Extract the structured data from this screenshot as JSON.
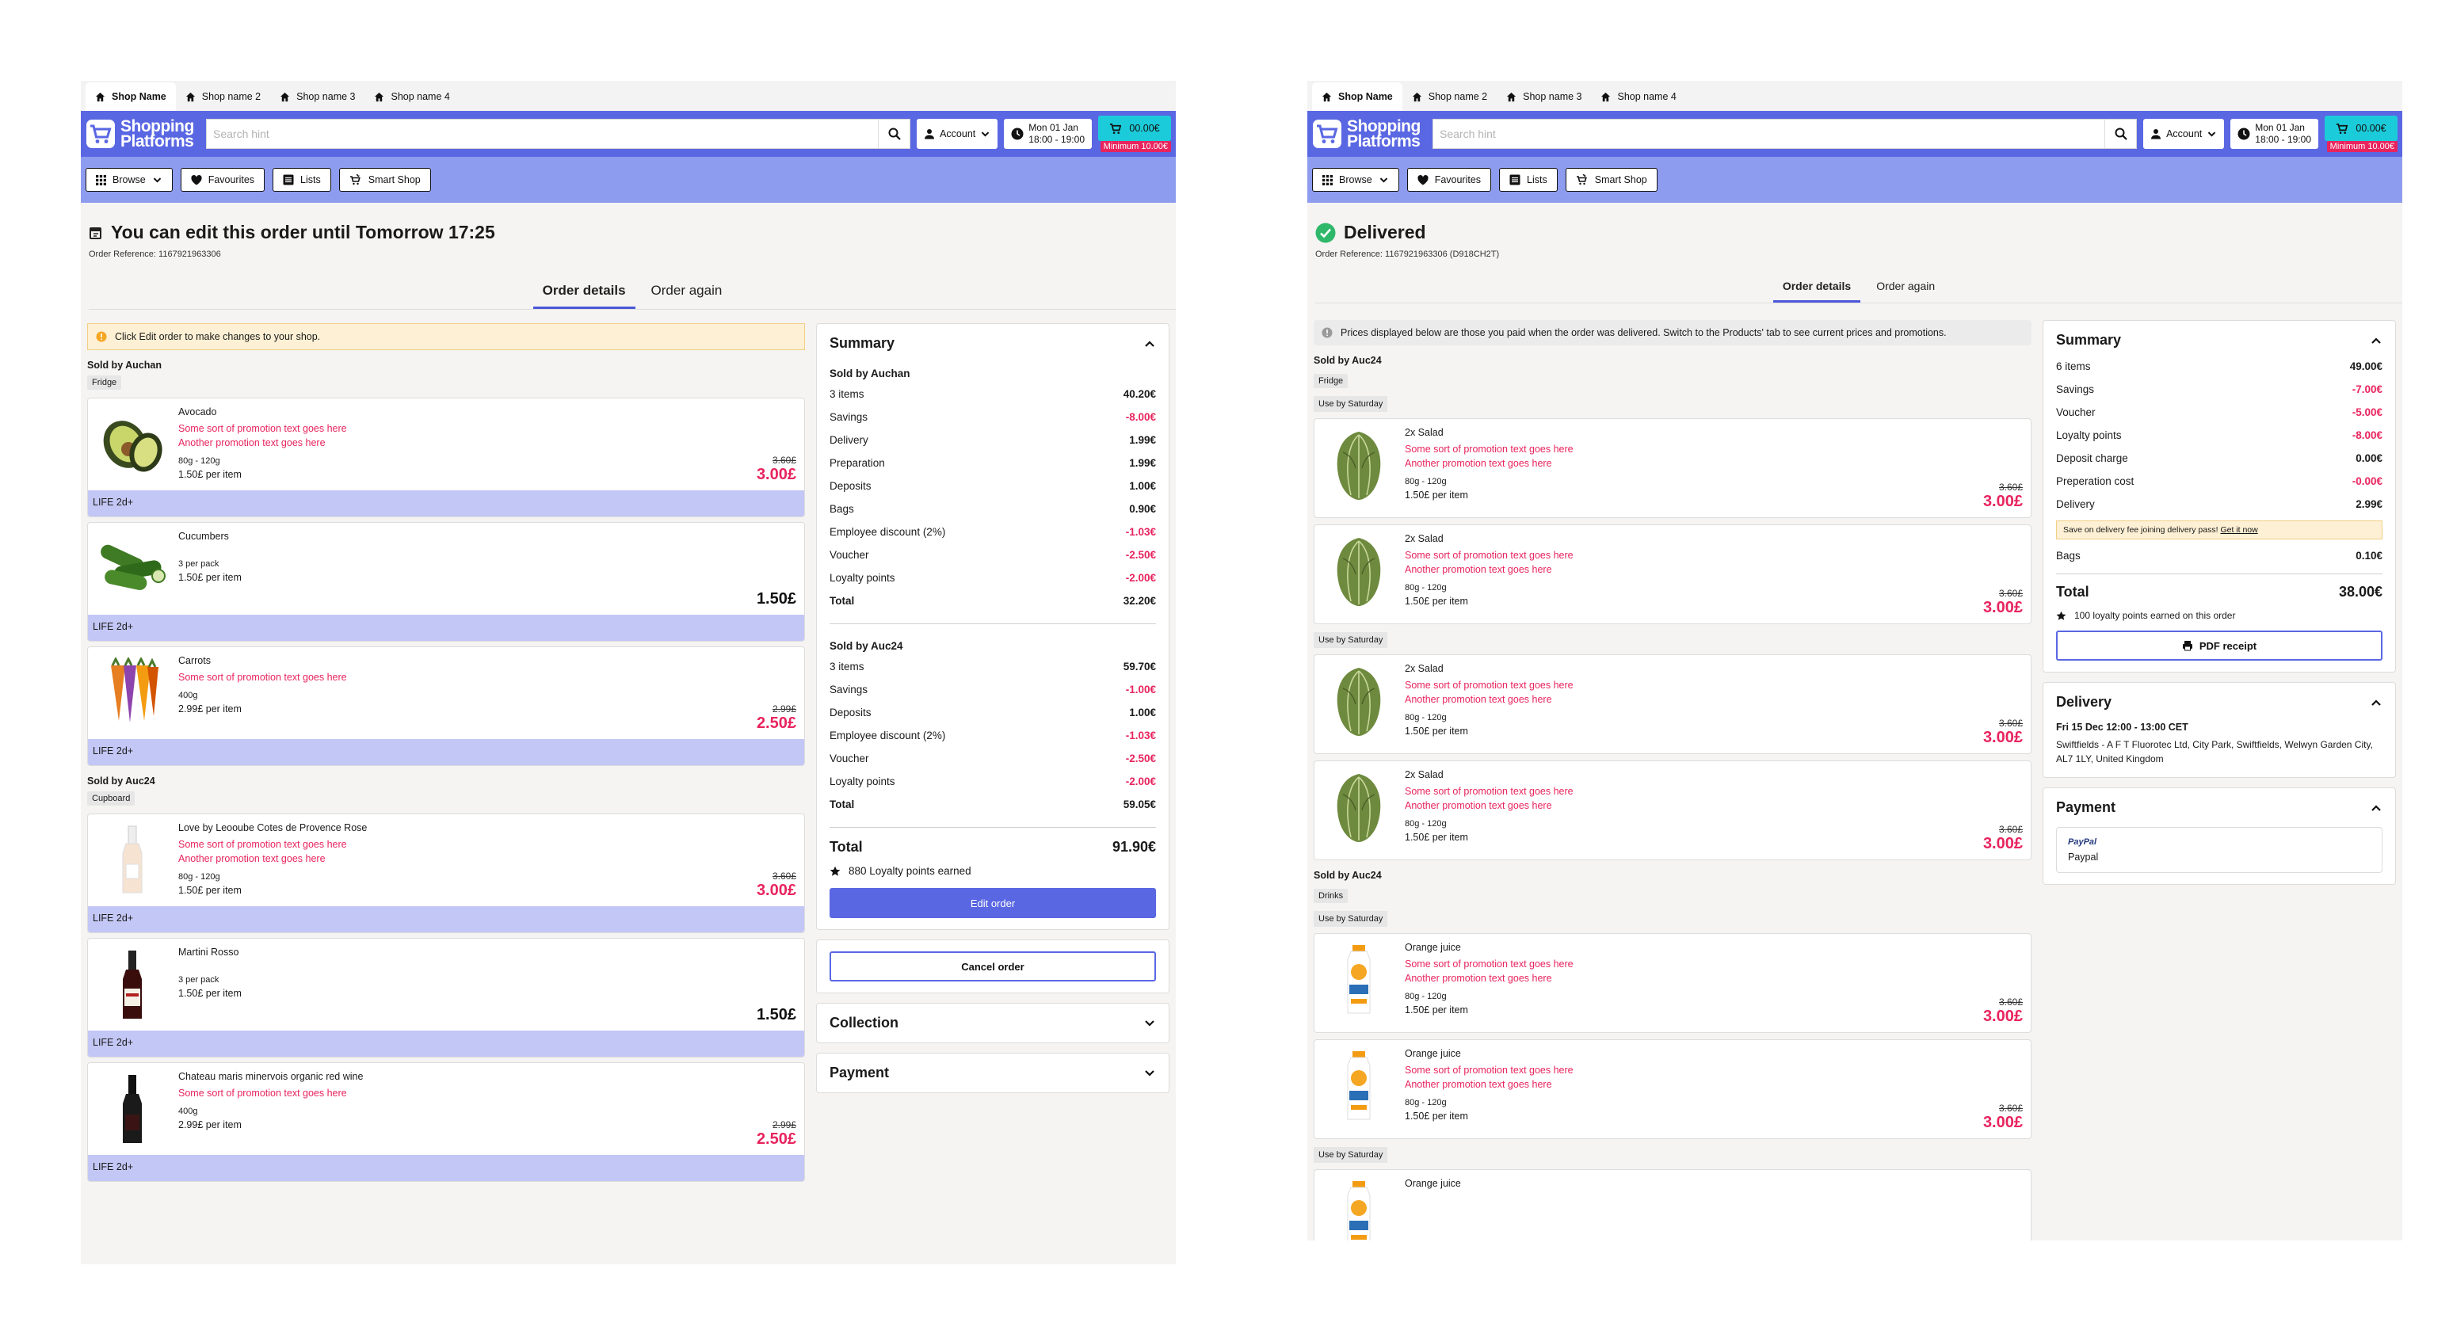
{
  "brand": {
    "line1": "Shopping",
    "line2": "Platforms"
  },
  "shop_tabs": [
    "Shop Name",
    "Shop name 2",
    "Shop name 3",
    "Shop name 4"
  ],
  "search": {
    "placeholder": "Search hint"
  },
  "account_label": "Account",
  "slot": {
    "day": "Mon 01 Jan",
    "time": "18:00 - 19:00"
  },
  "cart": {
    "amount": "00.00€",
    "minimum": "Minimum 10.00€"
  },
  "nav": [
    "Browse",
    "Favourites",
    "Lists",
    "Smart Shop"
  ],
  "order_tabs": [
    "Order details",
    "Order again"
  ],
  "left_screen": {
    "title": "You can edit this order until Tomorrow 17:25",
    "reference": "Order Reference: 1167921963306",
    "notice": "Click Edit order to make changes to your shop.",
    "groups": [
      {
        "seller": "Sold by Auchan",
        "tag": "Fridge",
        "items": [
          {
            "name": "Avocado",
            "promos": [
              "Some sort of promotion text goes here",
              "Another promotion text goes here"
            ],
            "weight": "80g - 120g",
            "unit": "1.50£ per item",
            "old": "3.60£",
            "price": "3.00£",
            "life": "LIFE 2d+",
            "img": "avocado"
          },
          {
            "name": "Cucumbers",
            "promos": [],
            "weight": "3 per pack",
            "unit": "1.50£ per item",
            "old": "",
            "price": "1.50£",
            "life": "LIFE 2d+",
            "img": "cucumber"
          },
          {
            "name": "Carrots",
            "promos": [
              "Some sort of promotion text goes here"
            ],
            "weight": "400g",
            "unit": "2.99£ per item",
            "old": "2.99£",
            "price": "2.50£",
            "life": "LIFE 2d+",
            "img": "carrot"
          }
        ]
      },
      {
        "seller": "Sold by Auc24",
        "tag": "Cupboard",
        "items": [
          {
            "name": "Love by Leooube Cotes de Provence Rose",
            "promos": [
              "Some sort of promotion text goes here",
              "Another promotion text goes here"
            ],
            "weight": "80g - 120g",
            "unit": "1.50£ per item",
            "old": "3.60£",
            "price": "3.00£",
            "life": "LIFE 2d+",
            "img": "rose"
          },
          {
            "name": "Martini Rosso",
            "promos": [],
            "weight": "3 per pack",
            "unit": "1.50£ per item",
            "old": "",
            "price": "1.50£",
            "life": "LIFE 2d+",
            "img": "martini"
          },
          {
            "name": "Chateau maris minervois organic red wine",
            "promos": [
              "Some sort of promotion text goes here"
            ],
            "weight": "400g",
            "unit": "2.99£ per item",
            "old": "2.99£",
            "price": "2.50£",
            "life": "LIFE 2d+",
            "img": "wine"
          }
        ]
      }
    ],
    "summary": {
      "title": "Summary",
      "sections": [
        {
          "seller": "Sold by Auchan",
          "rows": [
            {
              "label": "3 items",
              "value": "40.20€",
              "neg": false
            },
            {
              "label": "Savings",
              "value": "-8.00€",
              "neg": true
            },
            {
              "label": "Delivery",
              "value": "1.99€",
              "neg": false
            },
            {
              "label": "Preparation",
              "value": "1.99€",
              "neg": false
            },
            {
              "label": "Deposits",
              "value": "1.00€",
              "neg": false
            },
            {
              "label": "Bags",
              "value": "0.90€",
              "neg": false
            },
            {
              "label": "Employee discount (2%)",
              "value": "-1.03€",
              "neg": true
            },
            {
              "label": "Voucher",
              "value": "-2.50€",
              "neg": true
            },
            {
              "label": "Loyalty points",
              "value": "-2.00€",
              "neg": true
            },
            {
              "label": "Total",
              "value": "32.20€",
              "neg": false,
              "total": true
            }
          ]
        },
        {
          "seller": "Sold by Auc24",
          "rows": [
            {
              "label": "3 items",
              "value": "59.70€",
              "neg": false
            },
            {
              "label": "Savings",
              "value": "-1.00€",
              "neg": true
            },
            {
              "label": "Deposits",
              "value": "1.00€",
              "neg": false
            },
            {
              "label": "Employee discount (2%)",
              "value": "-1.03€",
              "neg": true
            },
            {
              "label": "Voucher",
              "value": "-2.50€",
              "neg": true
            },
            {
              "label": "Loyalty points",
              "value": "-2.00€",
              "neg": true
            },
            {
              "label": "Total",
              "value": "59.05€",
              "neg": false,
              "total": true
            }
          ]
        }
      ],
      "total_label": "Total",
      "total_value": "91.90€",
      "loyalty": "880 Loyalty points earned",
      "edit_button": "Edit order"
    },
    "cancel_button": "Cancel order",
    "collection_title": "Collection",
    "payment_title": "Payment"
  },
  "right_screen": {
    "title": "Delivered",
    "reference": "Order Reference: 1167921963306 (D918CH2T)",
    "info": "Prices displayed below are those you paid when the order was delivered. Switch to the Products' tab to see current prices and promotions.",
    "seller1": "Sold by Auc24",
    "tag1": "Fridge",
    "useby": "Use by Saturday",
    "salad_items": [
      {
        "name": "2x Salad",
        "promos": [
          "Some sort of promotion text goes here",
          "Another promotion text goes here"
        ],
        "weight": "80g - 120g",
        "unit": "1.50£ per item",
        "old": "3.60£",
        "price": "3.00£"
      },
      {
        "name": "2x Salad",
        "promos": [
          "Some sort of promotion text goes here",
          "Another promotion text goes here"
        ],
        "weight": "80g - 120g",
        "unit": "1.50£ per item",
        "old": "3.60£",
        "price": "3.00£"
      },
      {
        "name": "2x Salad",
        "promos": [
          "Some sort of promotion text goes here",
          "Another promotion text goes here"
        ],
        "weight": "80g - 120g",
        "unit": "1.50£ per item",
        "old": "3.60£",
        "price": "3.00£"
      },
      {
        "name": "2x Salad",
        "promos": [
          "Some sort of promotion text goes here",
          "Another promotion text goes here"
        ],
        "weight": "80g - 120g",
        "unit": "1.50£ per item",
        "old": "3.60£",
        "price": "3.00£"
      }
    ],
    "seller2": "Sold by Auc24",
    "tag2": "Drinks",
    "juice_items": [
      {
        "name": "Orange juice",
        "promos": [
          "Some sort of promotion text goes here",
          "Another promotion text goes here"
        ],
        "weight": "80g - 120g",
        "unit": "1.50£ per item",
        "old": "3.60£",
        "price": "3.00£"
      },
      {
        "name": "Orange juice",
        "promos": [
          "Some sort of promotion text goes here",
          "Another promotion text goes here"
        ],
        "weight": "80g - 120g",
        "unit": "1.50£ per item",
        "old": "3.60£",
        "price": "3.00£"
      },
      {
        "name": "Orange juice"
      }
    ],
    "summary": {
      "title": "Summary",
      "rows": [
        {
          "label": "6 items",
          "value": "49.00€",
          "neg": false
        },
        {
          "label": "Savings",
          "value": "-7.00€",
          "neg": true
        },
        {
          "label": "Voucher",
          "value": "-5.00€",
          "neg": true
        },
        {
          "label": "Loyalty points",
          "value": "-8.00€",
          "neg": true
        },
        {
          "label": "Deposit charge",
          "value": "0.00€",
          "neg": false
        },
        {
          "label": "Preperation cost",
          "value": "-0.00€",
          "neg": true
        },
        {
          "label": "Delivery",
          "value": "2.99€",
          "neg": false
        }
      ],
      "delivery_pass": "Save on delivery fee joining delivery pass!",
      "delivery_pass_link": "Get it now",
      "bags_label": "Bags",
      "bags_value": "0.10€",
      "total_label": "Total",
      "total_value": "38.00€",
      "loyalty": "100 loyalty points earned on this order",
      "pdf_button": "PDF receipt"
    },
    "delivery": {
      "title": "Delivery",
      "slot": "Fri 15 Dec 12:00 - 13:00 CET",
      "address": "Swiftfields - A F T Fluorotec Ltd, City Park, Swiftfields, Welwyn Garden City, AL7 1LY, United Kingdom"
    },
    "payment": {
      "title": "Payment",
      "brand": "PayPal",
      "method": "Paypal"
    }
  },
  "colors": {
    "primary": "#5a67e3",
    "subnav": "#8e9cf0",
    "cart": "#1ccbd9",
    "accent": "#e8245e",
    "life": "#c3c7f5"
  }
}
